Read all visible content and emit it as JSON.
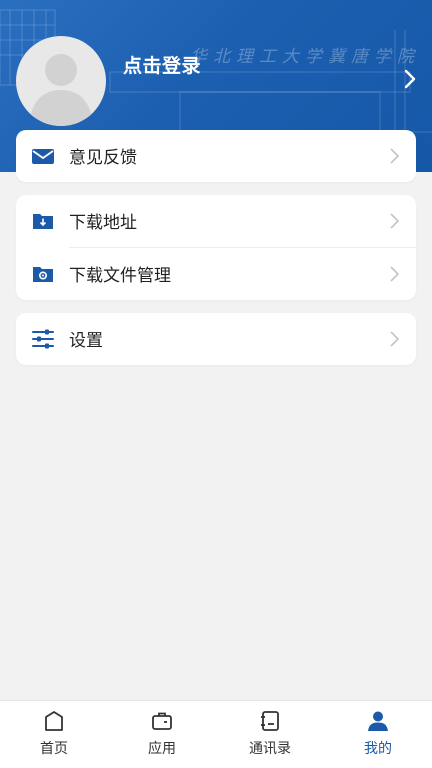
{
  "header": {
    "login_text": "点击登录",
    "watermark_text": "华北理工大学冀唐学院",
    "background_color": "#1c5fb0"
  },
  "menu": {
    "feedback_card": [
      {
        "icon": "mail-icon",
        "label": "意见反馈"
      }
    ],
    "download_card": [
      {
        "icon": "download-folder-icon",
        "label": "下载地址"
      },
      {
        "icon": "folder-settings-icon",
        "label": "下载文件管理"
      }
    ],
    "settings_card": [
      {
        "icon": "sliders-icon",
        "label": "设置"
      }
    ]
  },
  "tabbar": {
    "tabs": [
      {
        "icon": "home-icon",
        "label": "首页",
        "active": false
      },
      {
        "icon": "briefcase-icon",
        "label": "应用",
        "active": false
      },
      {
        "icon": "contacts-book-icon",
        "label": "通讯录",
        "active": false
      },
      {
        "icon": "person-icon",
        "label": "我的",
        "active": true
      }
    ]
  },
  "colors": {
    "accent": "#1b5aa8",
    "page_background": "#f2f2f2",
    "card_background": "#ffffff"
  }
}
